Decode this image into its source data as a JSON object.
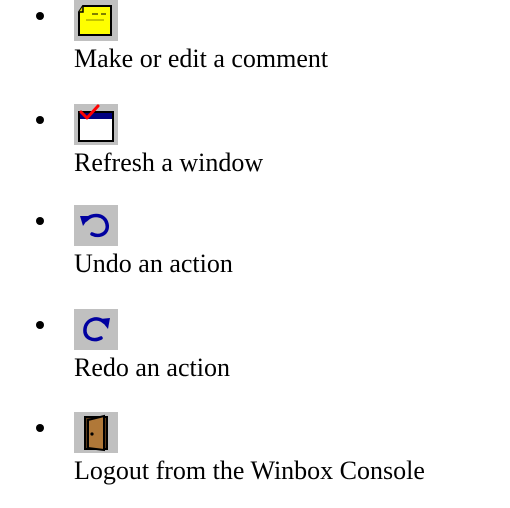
{
  "items": [
    {
      "icon": "comment-icon",
      "label": "Make or edit a comment"
    },
    {
      "icon": "refresh-icon",
      "label": "Refresh a window"
    },
    {
      "icon": "undo-icon",
      "label": "Undo an action"
    },
    {
      "icon": "redo-icon",
      "label": "Redo an action"
    },
    {
      "icon": "logout-door-icon",
      "label": "Logout from the Winbox Console"
    }
  ],
  "colors": {
    "icon_tile": "#c0c0c0",
    "comment_note": "#ffff00",
    "refresh_accent": "#ff0000",
    "refresh_bar": "#000080",
    "arrow_blue": "#0000a0",
    "door_wood": "#b07838"
  }
}
